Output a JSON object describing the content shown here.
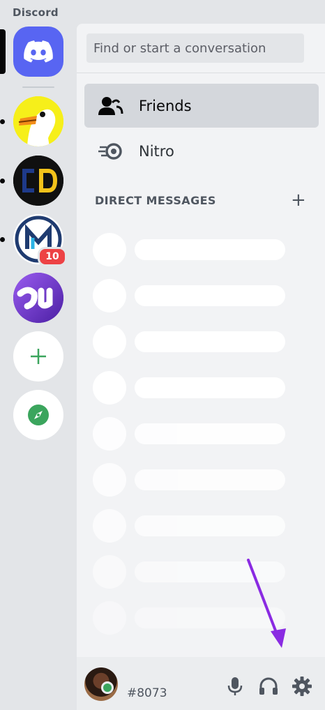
{
  "app": {
    "title": "Discord"
  },
  "servers": {
    "items": [
      {
        "name": "goose-server"
      },
      {
        "name": "cd-server"
      },
      {
        "name": "m-server",
        "badge": "10"
      },
      {
        "name": "purple-server"
      }
    ],
    "add_icon": "plus-icon",
    "explore_icon": "compass-icon"
  },
  "search": {
    "placeholder": "Find or start a conversation"
  },
  "nav": {
    "friends": {
      "label": "Friends",
      "icon": "friends-icon"
    },
    "nitro": {
      "label": "Nitro",
      "icon": "nitro-icon"
    }
  },
  "dm": {
    "header": "DIRECT MESSAGES",
    "add_label": "+"
  },
  "user": {
    "tag": "#8073",
    "status": "online"
  },
  "colors": {
    "blurple": "#5865f2",
    "online": "#3ba55d",
    "badge": "#ed4245",
    "arrow": "#8a2be2"
  }
}
